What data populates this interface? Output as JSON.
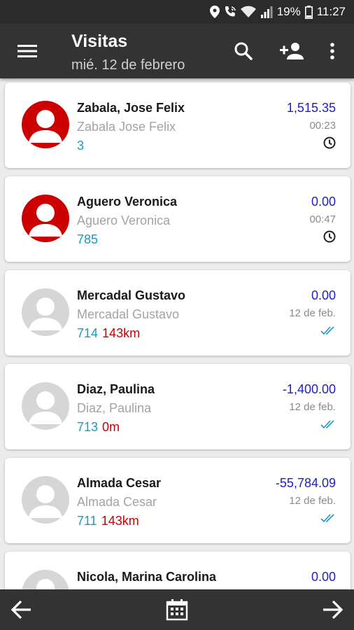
{
  "status_bar": {
    "battery": "19%",
    "time": "11:27",
    "icons": [
      "location-icon",
      "wifi-call-icon",
      "wifi-icon",
      "signal-icon",
      "battery-icon"
    ]
  },
  "app_bar": {
    "title": "Visitas",
    "subtitle": "mié. 12 de febrero",
    "icons": [
      "menu-icon",
      "search-icon",
      "add-person-icon",
      "more-vert-icon"
    ]
  },
  "visits": [
    {
      "name": "Zabala, Jose Felix",
      "alias": "Zabala Jose Felix",
      "code": "3",
      "distance": "",
      "amount": "1,515.35",
      "time": "00:23",
      "status_icon": "clock-icon",
      "avatar_color": "red"
    },
    {
      "name": "Aguero Veronica",
      "alias": "Aguero Veronica",
      "code": "785",
      "distance": "",
      "amount": "0.00",
      "time": "00:47",
      "status_icon": "clock-icon",
      "avatar_color": "red"
    },
    {
      "name": "Mercadal Gustavo",
      "alias": "Mercadal Gustavo",
      "code": "714",
      "distance": "143km",
      "amount": "0.00",
      "time": "12 de feb.",
      "status_icon": "double-check-icon",
      "avatar_color": "grey"
    },
    {
      "name": "Diaz, Paulina",
      "alias": "Diaz, Paulina",
      "code": "713",
      "distance": "0m",
      "amount": "-1,400.00",
      "time": "12 de feb.",
      "status_icon": "double-check-icon",
      "avatar_color": "grey"
    },
    {
      "name": "Almada Cesar",
      "alias": "Almada Cesar",
      "code": "711",
      "distance": "143km",
      "amount": "-55,784.09",
      "time": "12 de feb.",
      "status_icon": "double-check-icon",
      "avatar_color": "grey"
    },
    {
      "name": "Nicola, Marina Carolina",
      "alias": "",
      "code": "",
      "distance": "",
      "amount": "0.00",
      "time": "",
      "status_icon": "",
      "avatar_color": "grey"
    }
  ],
  "bottom_bar": {
    "icons": [
      "arrow-back-icon",
      "calendar-icon",
      "arrow-forward-icon"
    ]
  },
  "colors": {
    "app_bar": "#333333",
    "amount": "#1f1fbf",
    "code": "#1a9bc2",
    "distance": "#cc0000",
    "avatar_active": "#cc0000",
    "avatar_inactive": "#d6d6d6",
    "double_check": "#1a9bc2"
  }
}
